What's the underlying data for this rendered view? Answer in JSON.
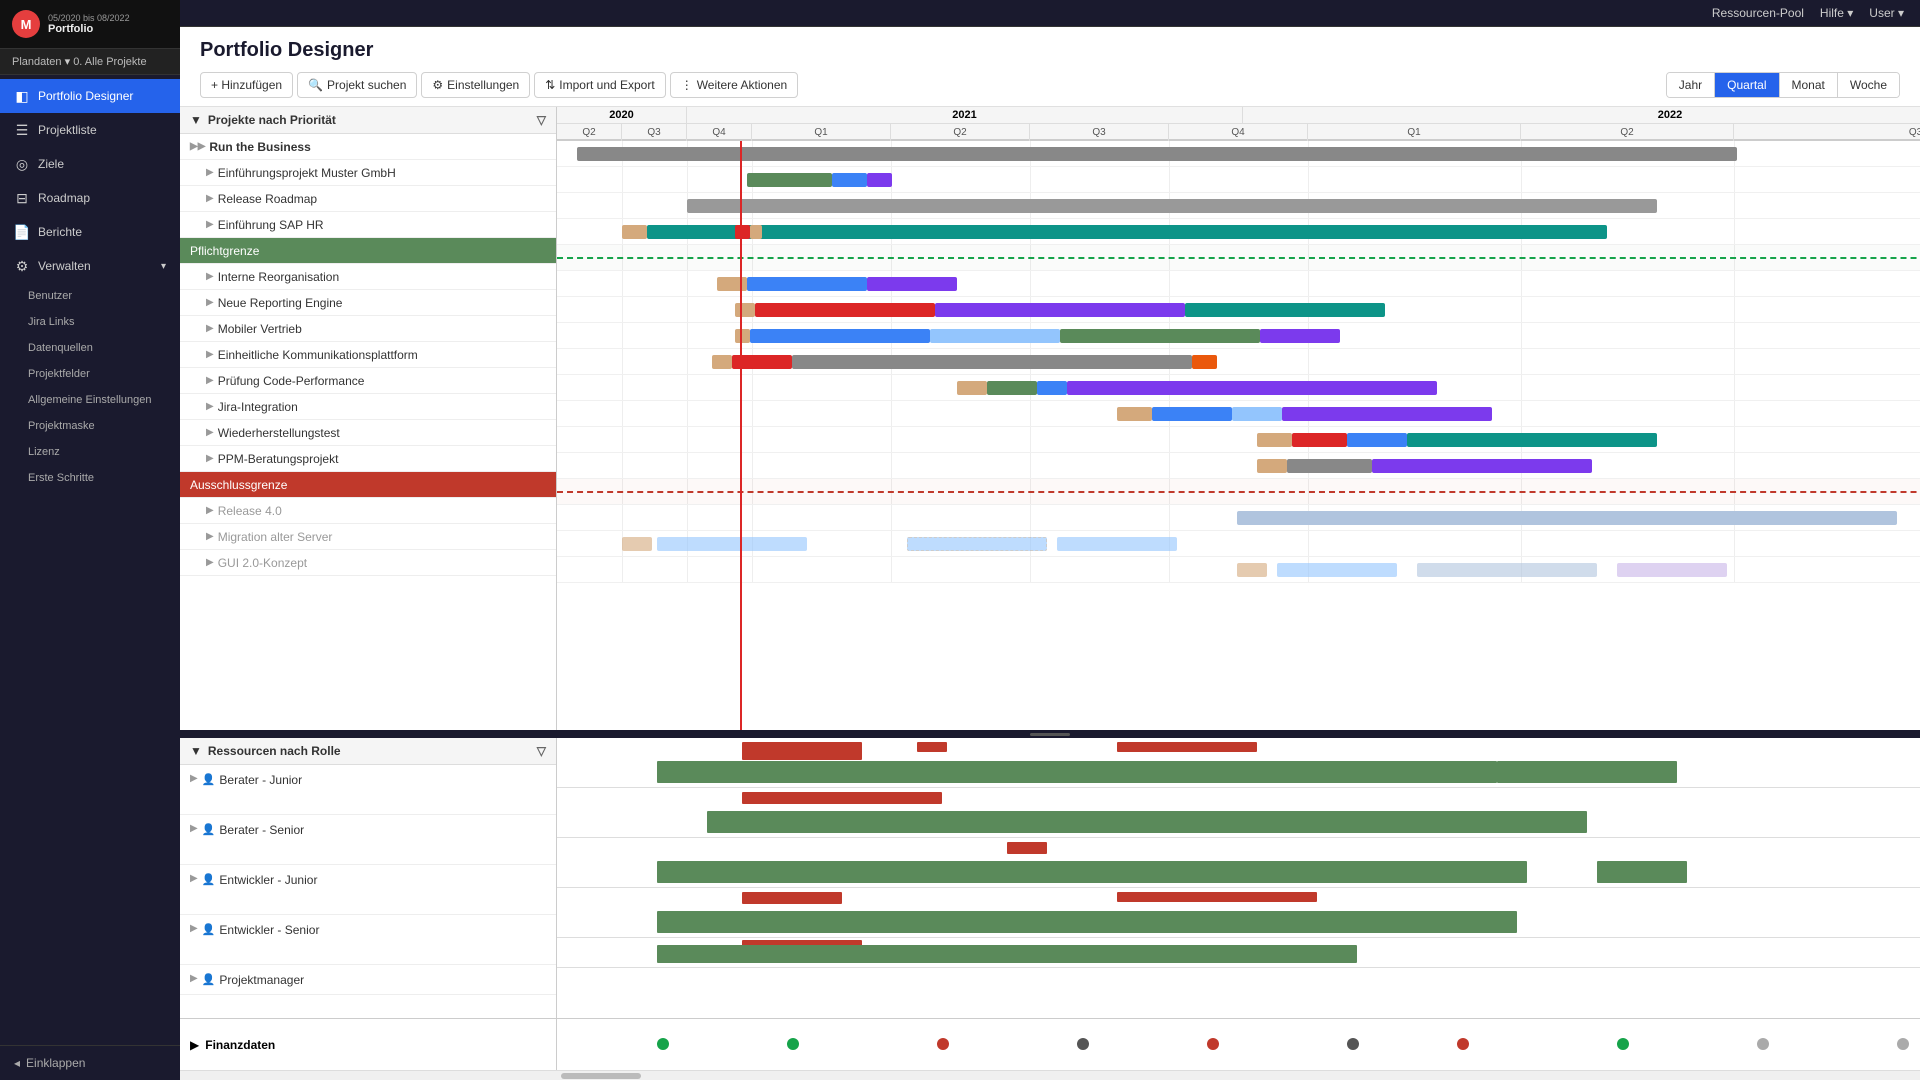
{
  "topbar": {
    "resources_pool": "Ressourcen-Pool",
    "help": "Hilfe",
    "user": "User"
  },
  "sidebar": {
    "logo": "M",
    "date_range": "05/2020 bis 08/2022",
    "portfolio": "Portfolio",
    "plan_data": "0. Alle Projekte",
    "plan_label": "Plandaten",
    "items": [
      {
        "id": "portfolio-designer",
        "label": "Portfolio Designer",
        "icon": "◧",
        "active": true
      },
      {
        "id": "projektliste",
        "label": "Projektliste",
        "icon": "☰"
      },
      {
        "id": "ziele",
        "label": "Ziele",
        "icon": "◎"
      },
      {
        "id": "roadmap",
        "label": "Roadmap",
        "icon": "⊟"
      },
      {
        "id": "berichte",
        "label": "Berichte",
        "icon": "📄"
      },
      {
        "id": "verwalten",
        "label": "Verwalten",
        "icon": "⚙",
        "has_arrow": true
      }
    ],
    "sub_items": [
      "Benutzer",
      "Jira Links",
      "Datenquellen",
      "Projektfelder",
      "Allgemeine Einstellungen",
      "Projektmaske",
      "Lizenz",
      "Erste Schritte"
    ],
    "collapse": "Einklappen"
  },
  "header": {
    "title": "Portfolio Designer"
  },
  "toolbar": {
    "add": "+ Hinzufügen",
    "search": "Projekt suchen",
    "settings": "Einstellungen",
    "import_export": "Import und Export",
    "more_actions": "Weitere Aktionen"
  },
  "time_buttons": {
    "year": "Jahr",
    "quarter": "Quartal",
    "month": "Monat",
    "week": "Woche",
    "active": "Quartal"
  },
  "projects_panel": {
    "header": "Projekte nach Priorität",
    "rows": [
      {
        "name": "Run the Business",
        "type": "group",
        "expandable": true
      },
      {
        "name": "Einführungsprojekt Muster GmbH",
        "type": "project",
        "expandable": true
      },
      {
        "name": "Release Roadmap",
        "type": "project",
        "expandable": true
      },
      {
        "name": "Einführung SAP HR",
        "type": "project",
        "expandable": true
      },
      {
        "name": "Pflichtgrenze",
        "type": "boundary-green",
        "expandable": false
      },
      {
        "name": "Interne Reorganisation",
        "type": "project",
        "expandable": true
      },
      {
        "name": "Neue Reporting Engine",
        "type": "project",
        "expandable": true
      },
      {
        "name": "Mobiler Vertrieb",
        "type": "project",
        "expandable": true
      },
      {
        "name": "Einheitliche Kommunikationsplattform",
        "type": "project",
        "expandable": true
      },
      {
        "name": "Prüfung Code-Performance",
        "type": "project",
        "expandable": true
      },
      {
        "name": "Jira-Integration",
        "type": "project",
        "expandable": true
      },
      {
        "name": "Wiederherstellungstest",
        "type": "project",
        "expandable": true
      },
      {
        "name": "PPM-Beratungsprojekt",
        "type": "project",
        "expandable": true
      },
      {
        "name": "Ausschlussgrenze",
        "type": "boundary-red",
        "expandable": false
      },
      {
        "name": "Release 4.0",
        "type": "project-sub",
        "expandable": true
      },
      {
        "name": "Migration alter Server",
        "type": "project-sub",
        "expandable": true
      },
      {
        "name": "GUI 2.0-Konzept",
        "type": "project-sub",
        "expandable": true
      }
    ]
  },
  "resources_panel": {
    "header": "Ressourcen nach Rolle",
    "rows": [
      {
        "name": "Berater - Junior"
      },
      {
        "name": "Berater - Senior"
      },
      {
        "name": "Entwickler - Junior"
      },
      {
        "name": "Entwickler - Senior"
      },
      {
        "name": "Projektmanager"
      }
    ]
  },
  "finance_panel": {
    "label": "Finanzdaten"
  },
  "timeline": {
    "years": [
      {
        "label": "2020",
        "quarters": 3,
        "width_pct": 22
      },
      {
        "label": "2021",
        "quarters": 4,
        "width_pct": 37
      },
      {
        "label": "2022",
        "quarters": 3,
        "width_pct": 41
      }
    ],
    "quarters": [
      "Q2",
      "Q3",
      "Q4",
      "Q1",
      "Q2",
      "Q3",
      "Q4",
      "Q1",
      "Q2",
      "Q3"
    ]
  },
  "colors": {
    "accent_blue": "#2563eb",
    "sidebar_bg": "#1a1a2e",
    "boundary_green": "#5a8a5a",
    "boundary_red": "#c0392b",
    "today_line": "#dc2626"
  }
}
